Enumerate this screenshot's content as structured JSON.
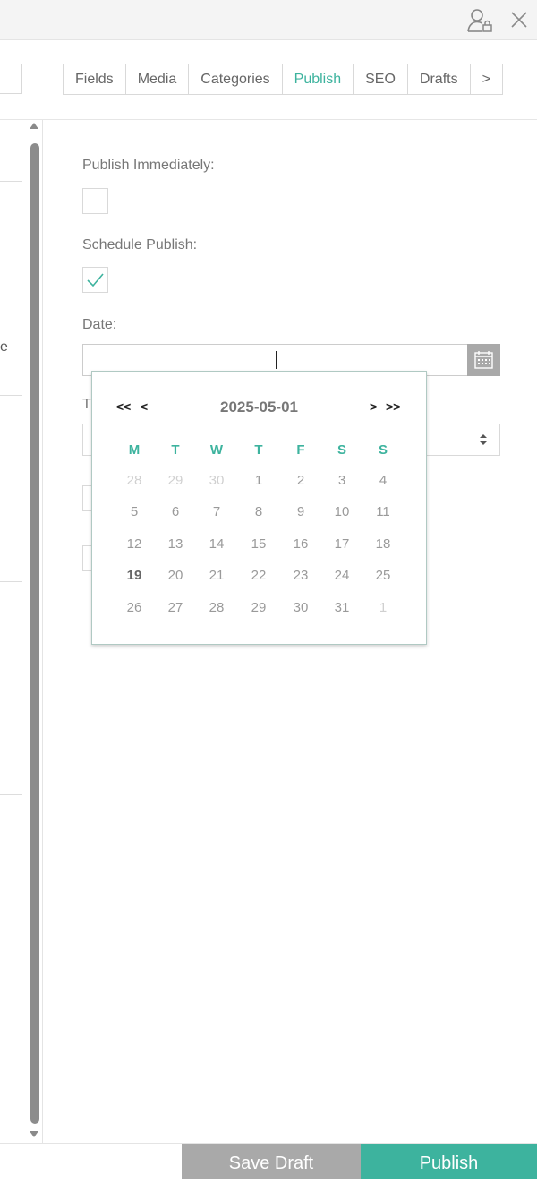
{
  "header": {
    "icons": [
      "user-lock-icon",
      "close-icon"
    ]
  },
  "tabs": [
    {
      "label": "Fields",
      "active": false
    },
    {
      "label": "Media",
      "active": false
    },
    {
      "label": "Categories",
      "active": false
    },
    {
      "label": "Publish",
      "active": true
    },
    {
      "label": "SEO",
      "active": false
    },
    {
      "label": "Drafts",
      "active": false
    },
    {
      "label": ">",
      "active": false
    }
  ],
  "left_panel": {
    "fragment_text": "e"
  },
  "form": {
    "publish_immediately_label": "Publish Immediately:",
    "publish_immediately_checked": false,
    "schedule_publish_label": "Schedule Publish:",
    "schedule_publish_checked": true,
    "date_label": "Date:",
    "date_value": "",
    "time_label_partial": "T"
  },
  "datepicker": {
    "title": "2025-05-01",
    "prev_year": "<<",
    "prev_month": "<",
    "next_month": ">",
    "next_year": ">>",
    "weekdays": [
      "M",
      "T",
      "W",
      "T",
      "F",
      "S",
      "S"
    ],
    "weeks": [
      [
        {
          "d": "28",
          "o": true
        },
        {
          "d": "29",
          "o": true
        },
        {
          "d": "30",
          "o": true
        },
        {
          "d": "1"
        },
        {
          "d": "2"
        },
        {
          "d": "3"
        },
        {
          "d": "4"
        }
      ],
      [
        {
          "d": "5"
        },
        {
          "d": "6"
        },
        {
          "d": "7"
        },
        {
          "d": "8"
        },
        {
          "d": "9"
        },
        {
          "d": "10"
        },
        {
          "d": "11"
        }
      ],
      [
        {
          "d": "12"
        },
        {
          "d": "13"
        },
        {
          "d": "14"
        },
        {
          "d": "15"
        },
        {
          "d": "16"
        },
        {
          "d": "17"
        },
        {
          "d": "18"
        }
      ],
      [
        {
          "d": "19",
          "today": true
        },
        {
          "d": "20"
        },
        {
          "d": "21"
        },
        {
          "d": "22"
        },
        {
          "d": "23"
        },
        {
          "d": "24"
        },
        {
          "d": "25"
        }
      ],
      [
        {
          "d": "26"
        },
        {
          "d": "27"
        },
        {
          "d": "28"
        },
        {
          "d": "29"
        },
        {
          "d": "30"
        },
        {
          "d": "31"
        },
        {
          "d": "1",
          "o": true
        }
      ]
    ]
  },
  "footer": {
    "save_draft_label": "Save Draft",
    "publish_label": "Publish"
  },
  "colors": {
    "accent": "#3db39e",
    "button_gray": "#a9a9a9",
    "text": "#777777"
  }
}
